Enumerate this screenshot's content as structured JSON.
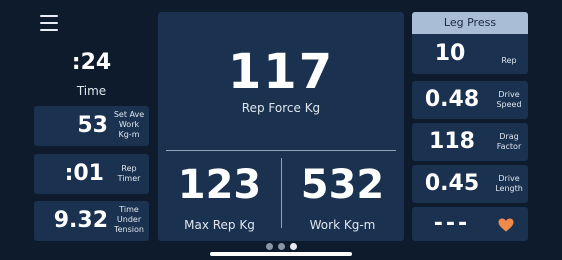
{
  "exercise": {
    "title": "Leg Press"
  },
  "time": {
    "value": ":24",
    "label": "Time"
  },
  "left_stats": [
    {
      "value": "53",
      "caption_lines": [
        "Set Ave",
        "Work",
        "Kg-m"
      ]
    },
    {
      "value": ":01",
      "caption_lines": [
        "Rep",
        "Timer"
      ]
    },
    {
      "value": "9.32",
      "caption_lines": [
        "Time",
        "Under",
        "Tension"
      ]
    }
  ],
  "main": {
    "rep_force": {
      "value": "117",
      "label": "Rep Force Kg"
    },
    "max_rep": {
      "value": "123",
      "label": "Max Rep Kg"
    },
    "work": {
      "value": "532",
      "label": "Work Kg-m"
    }
  },
  "right_stats": [
    {
      "value": "10",
      "caption_lines": [
        "Rep"
      ]
    },
    {
      "value": "0.48",
      "caption_lines": [
        "Drive",
        "Speed"
      ]
    },
    {
      "value": "118",
      "caption_lines": [
        "Drag",
        "Factor"
      ]
    },
    {
      "value": "0.45",
      "caption_lines": [
        "Drive",
        "Length"
      ]
    },
    {
      "value": "---",
      "icon": "heart-icon"
    }
  ],
  "pager": {
    "pages": 3,
    "active_index": 2
  },
  "colors": {
    "background": "#0d1b2c",
    "card": "#1a3150",
    "header": "#a9bdd6",
    "heart": "#f08a4b"
  },
  "icons": {
    "menu": "hamburger-menu-icon",
    "heart": "heart-icon"
  }
}
